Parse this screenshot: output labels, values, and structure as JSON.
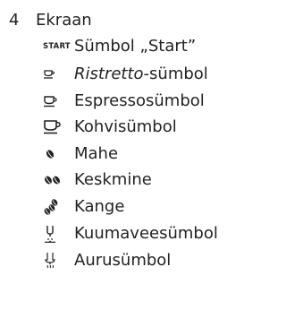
{
  "section": {
    "number": "4",
    "title": "Ekraan"
  },
  "items": [
    {
      "icon": "start-text-icon",
      "icon_text": "START",
      "label": "Sümbol „Start”"
    },
    {
      "icon": "ristretto-cup-icon",
      "label_italic": "Ristretto",
      "label_rest": "-sümbol"
    },
    {
      "icon": "espresso-cup-icon",
      "label": "Espressosümbol"
    },
    {
      "icon": "coffee-cup-icon",
      "label": "Kohvisümbol"
    },
    {
      "icon": "one-bean-icon",
      "label": "Mahe"
    },
    {
      "icon": "two-beans-icon",
      "label": "Keskmine"
    },
    {
      "icon": "three-beans-icon",
      "label": "Kange"
    },
    {
      "icon": "hot-water-icon",
      "label": "Kuumaveesümbol"
    },
    {
      "icon": "steam-icon",
      "label": "Aurusümbol"
    }
  ]
}
